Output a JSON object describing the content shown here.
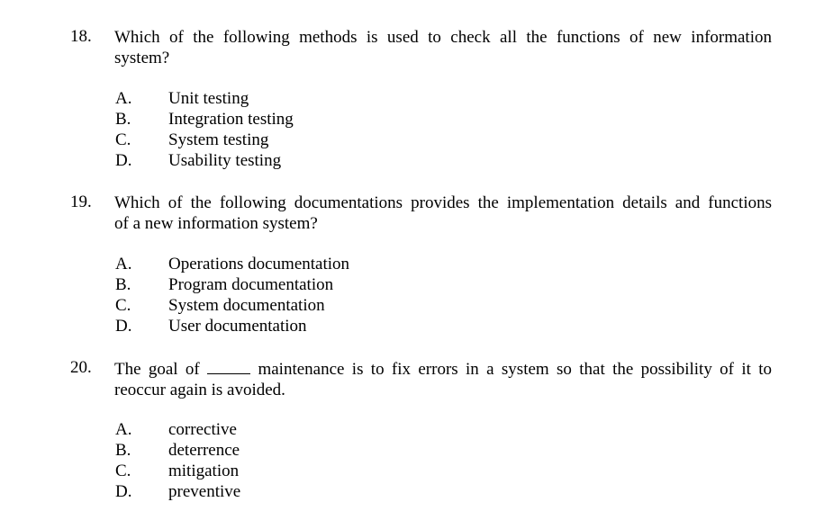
{
  "questions": [
    {
      "number": "18.",
      "text_line1": "Which of the following methods is used to check all the functions of new information",
      "text_line2": "system?",
      "options": [
        {
          "letter": "A.",
          "text": "Unit testing"
        },
        {
          "letter": "B.",
          "text": "Integration testing"
        },
        {
          "letter": "C.",
          "text": "System testing"
        },
        {
          "letter": "D.",
          "text": "Usability testing"
        }
      ]
    },
    {
      "number": "19.",
      "text_line1": "Which of the following documentations provides the implementation details and functions",
      "text_line2": "of a new information system?",
      "options": [
        {
          "letter": "A.",
          "text": "Operations documentation"
        },
        {
          "letter": "B.",
          "text": "Program documentation"
        },
        {
          "letter": "C.",
          "text": "System documentation"
        },
        {
          "letter": "D.",
          "text": "User documentation"
        }
      ]
    },
    {
      "number": "20.",
      "text_line1_before": "The goal of",
      "text_line1_after": "maintenance is to fix errors in a system so that the possibility of it to",
      "text_line2": "reoccur again is avoided.",
      "options": [
        {
          "letter": "A.",
          "text": "corrective"
        },
        {
          "letter": "B.",
          "text": "deterrence"
        },
        {
          "letter": "C.",
          "text": "mitigation"
        },
        {
          "letter": "D.",
          "text": "preventive"
        }
      ]
    }
  ]
}
